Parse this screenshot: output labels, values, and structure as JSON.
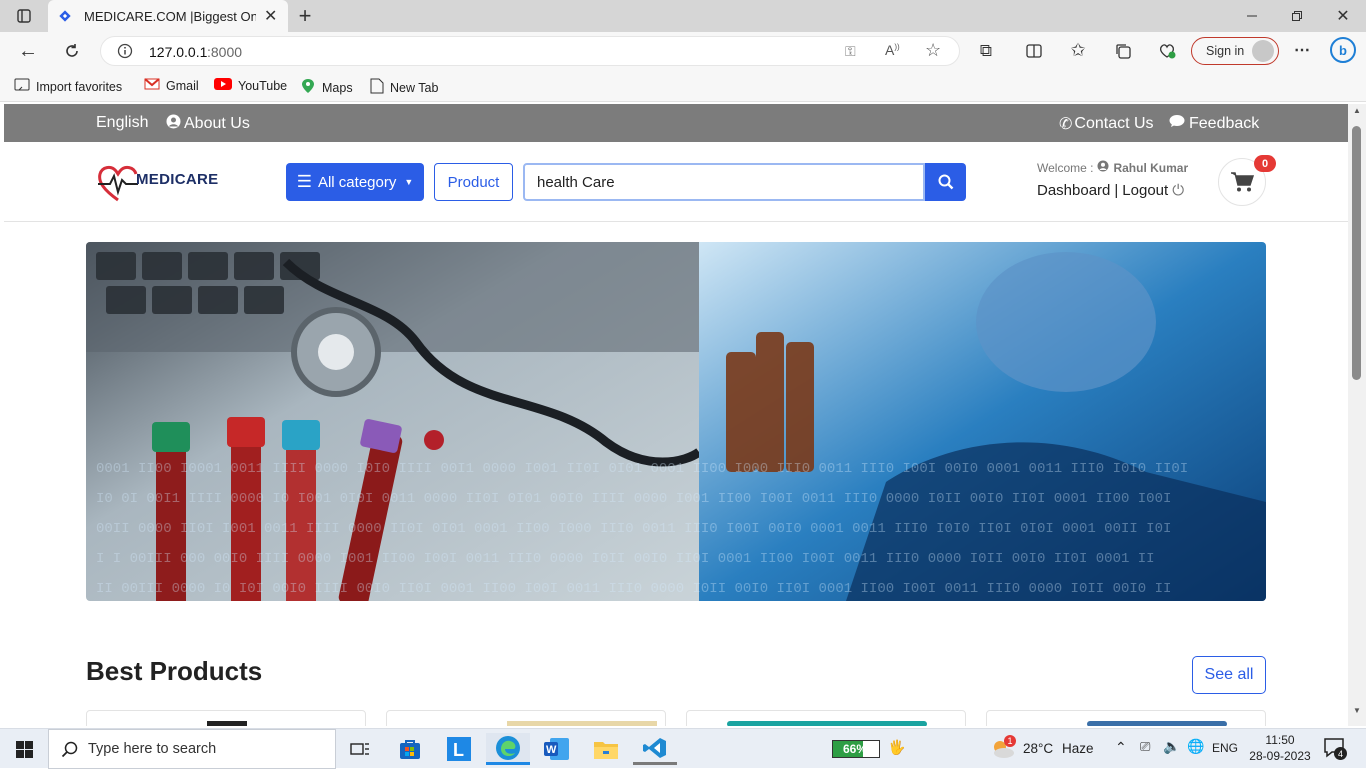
{
  "browser": {
    "tab_title": "MEDICARE.COM |Biggest Online",
    "url_host": "127.0.0.1",
    "url_port": ":8000",
    "signin_label": "Sign in",
    "favorites": [
      "Import favorites",
      "Gmail",
      "YouTube",
      "Maps",
      "New Tab"
    ]
  },
  "topnav": {
    "language": "English",
    "about": "About Us",
    "contact": "Contact Us",
    "feedback": "Feedback"
  },
  "header": {
    "logo_text": "MEDICARE",
    "category_label": "All category",
    "product_label": "Product",
    "search_value": "health Care",
    "welcome_label": "Welcome :",
    "user_name": "Rahul Kumar",
    "dashboard_label": "Dashboard",
    "separator": "|",
    "logout_label": "Logout",
    "cart_count": "0"
  },
  "main": {
    "section_title": "Best Products",
    "see_all_label": "See all"
  },
  "taskbar": {
    "search_placeholder": "Type here to search",
    "battery": "66%",
    "weather_temp": "28°C",
    "weather_desc": "Haze",
    "lang": "ENG",
    "time": "11:50",
    "date": "28-09-2023",
    "notif_count": "4",
    "weather_alert": "1"
  },
  "colors": {
    "brand_blue": "#2b5de6",
    "topnav_gray": "#7c7c7c",
    "cart_badge": "#e53935"
  }
}
